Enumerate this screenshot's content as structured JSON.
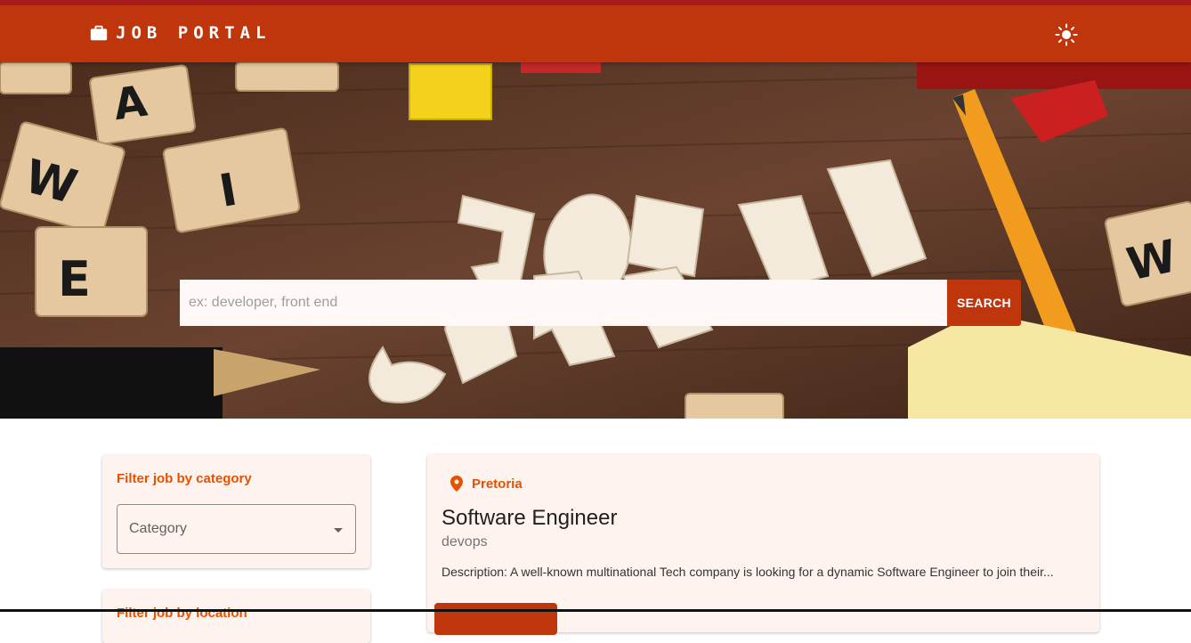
{
  "appbar": {
    "brand_icon": "briefcase-icon",
    "title": "JOB PORTAL",
    "theme_toggle_icon": "sun-icon",
    "color": "#bf360c"
  },
  "hero": {
    "background": "job-search-scrabble-photo",
    "search": {
      "placeholder": "ex: developer, front end",
      "value": "",
      "button_label": "SEARCH"
    }
  },
  "filters": {
    "category_card": {
      "title": "Filter job by category",
      "select_label": "Category",
      "select_icon": "caret-down-icon"
    },
    "location_card": {
      "title": "Filter job by location"
    }
  },
  "jobs": [
    {
      "location_icon": "location-pin-icon",
      "location": "Pretoria",
      "title": "Software Engineer",
      "category": "devops",
      "description": "Description: A well-known multinational Tech company is looking for a dynamic Software Engineer to join their..."
    }
  ],
  "colors": {
    "accent": "#bf360c",
    "highlight_text": "#e65100",
    "card_background": "#fff3ef"
  }
}
